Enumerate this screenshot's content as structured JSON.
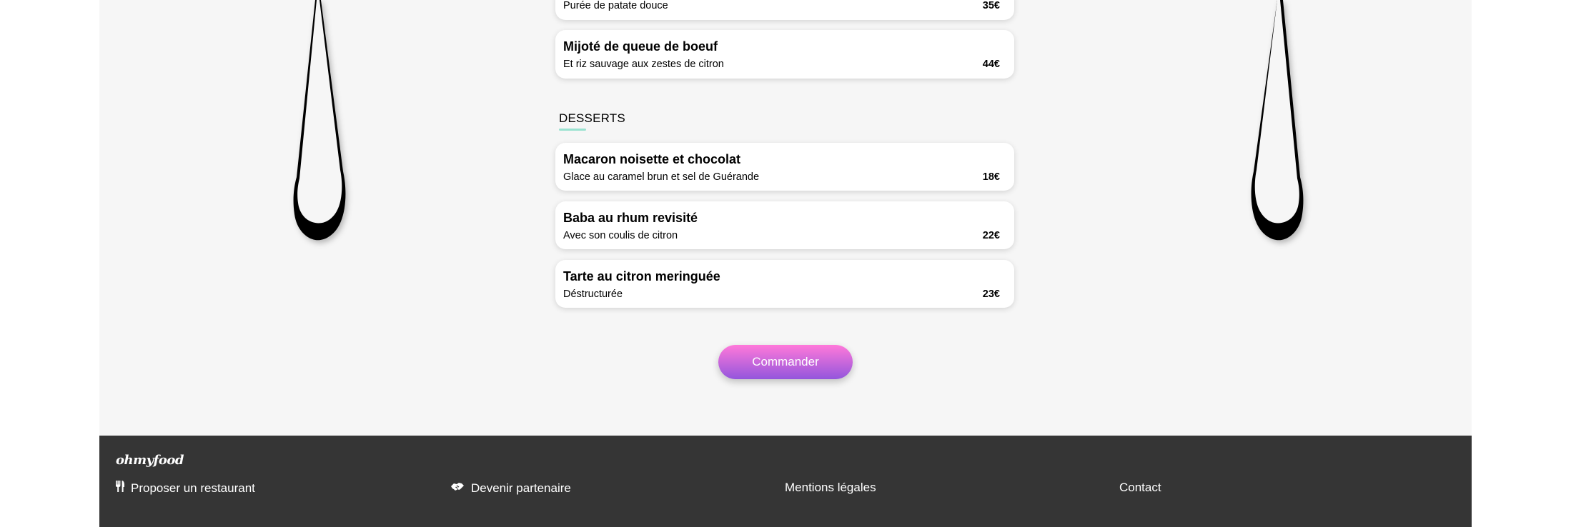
{
  "menu": {
    "previous_dish": {
      "description": "Purée de patate douce",
      "price": "35€"
    },
    "mains_last": {
      "name": "Mijoté de queue de boeuf",
      "description": "Et riz sauvage aux zestes de citron",
      "price": "44€"
    },
    "desserts": {
      "title": "DESSERTS",
      "items": [
        {
          "name": "Macaron noisette et chocolat",
          "description": "Glace au caramel brun et sel de Guérande",
          "price": "18€"
        },
        {
          "name": "Baba au rhum revisité",
          "description": "Avec son coulis de citron",
          "price": "22€"
        },
        {
          "name": "Tarte au citron meringuée",
          "description": "Déstructurée",
          "price": "23€"
        }
      ]
    }
  },
  "order_button": {
    "label": "Commander"
  },
  "footer": {
    "logo": "ohmyfood",
    "links": {
      "propose": {
        "label": "Proposer un restaurant",
        "icon": "utensils-icon"
      },
      "partner": {
        "label": "Devenir partenaire",
        "icon": "handshake-icon"
      },
      "legal": {
        "label": "Mentions légales"
      },
      "contact": {
        "label": "Contact"
      }
    }
  },
  "colors": {
    "page_background": "#f6f6f6",
    "footer_background": "#353535",
    "accent_underline": "#99e2d0",
    "button_gradient_top": "#ff79da",
    "button_gradient_bottom": "#9356dc"
  }
}
